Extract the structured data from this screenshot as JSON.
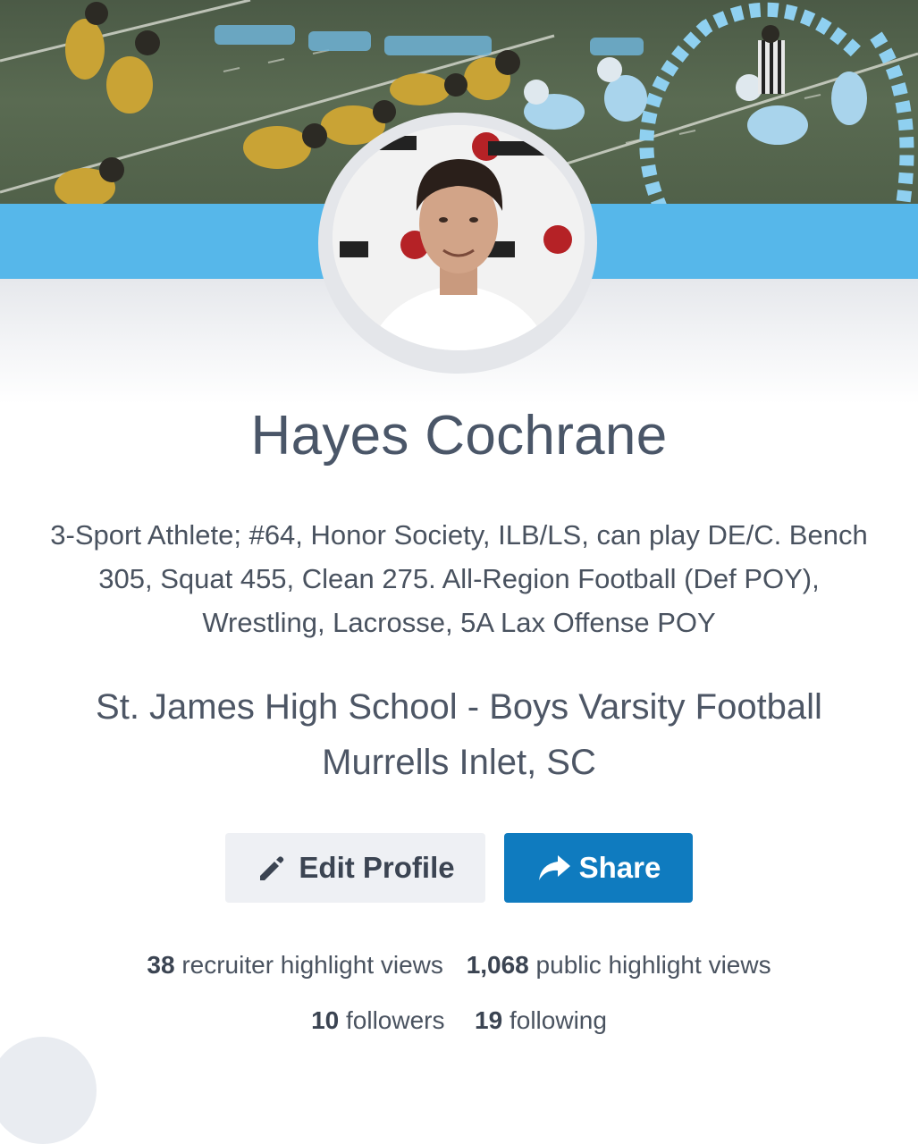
{
  "profile": {
    "name": "Hayes Cochrane",
    "bio": "3-Sport Athlete; #64, Honor Society, ILB/LS, can play DE/C. Bench 305, Squat 455, Clean 275. All-Region Football (Def POY), Wrestling, Lacrosse, 5A Lax Offense POY",
    "school": "St. James High School - Boys Varsity Football",
    "location": "Murrells Inlet, SC"
  },
  "actions": {
    "edit_label": "Edit Profile",
    "edit_icon": "pencil-icon",
    "share_label": "Share",
    "share_icon": "share-arrow-icon"
  },
  "stats": {
    "recruiter_views_count": "38",
    "recruiter_views_label": "recruiter highlight views",
    "public_views_count": "1,068",
    "public_views_label": "public highlight views",
    "followers_count": "10",
    "followers_label": "followers",
    "following_count": "19",
    "following_label": "following"
  },
  "colors": {
    "accent_blue": "#56b7ea",
    "share_button": "#0f7bbf",
    "edit_button": "#eef0f4",
    "text": "#4a5668"
  }
}
